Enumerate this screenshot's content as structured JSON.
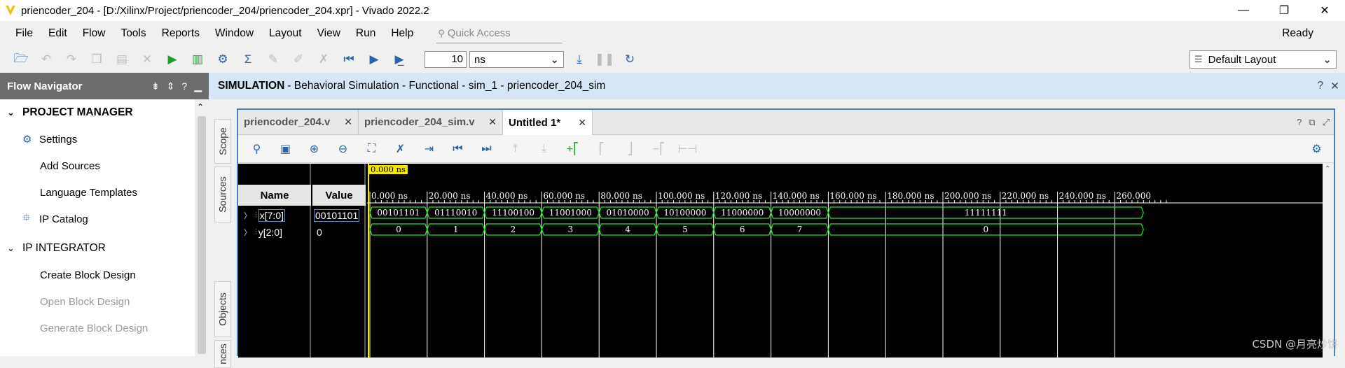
{
  "window": {
    "title": "priencoder_204 - [D:/Xilinx/Project/priencoder_204/priencoder_204.xpr] - Vivado 2022.2",
    "controls": {
      "minimize": "—",
      "restore": "❐",
      "close": "✕"
    }
  },
  "menu": {
    "items": [
      "File",
      "Edit",
      "Flow",
      "Tools",
      "Reports",
      "Window",
      "Layout",
      "View",
      "Run",
      "Help"
    ],
    "quick_access_placeholder": "Quick Access",
    "status": "Ready"
  },
  "toolbar": {
    "run_time_value": "10",
    "run_time_unit": "ns",
    "layout": "Default Layout"
  },
  "flow_navigator": {
    "title": "Flow Navigator",
    "sections": [
      {
        "label": "PROJECT MANAGER",
        "items": [
          "Settings",
          "Add Sources",
          "Language Templates",
          "IP Catalog"
        ]
      },
      {
        "label": "IP INTEGRATOR",
        "items": [
          "Create Block Design",
          "Open Block Design",
          "Generate Block Design"
        ]
      }
    ]
  },
  "sim_header": {
    "label": "SIMULATION",
    "text": "- Behavioral Simulation - Functional - sim_1 - priencoder_204_sim"
  },
  "side_tabs": [
    "Scope",
    "Sources",
    "Objects",
    "nces"
  ],
  "editor_tabs": [
    {
      "label": "priencoder_204.v",
      "active": false
    },
    {
      "label": "priencoder_204_sim.v",
      "active": false
    },
    {
      "label": "Untitled 1*",
      "active": true
    }
  ],
  "waveform": {
    "cursor_label": "0.000 ns",
    "columns": {
      "name": "Name",
      "value": "Value"
    },
    "time_ticks": [
      "0.000 ns",
      "20.000 ns",
      "40.000 ns",
      "60.000 ns",
      "80.000 ns",
      "100.000 ns",
      "120.000 ns",
      "140.000 ns",
      "160.000 ns",
      "180.000 ns",
      "200.000 ns",
      "220.000 ns",
      "240.000 ns",
      "260.000"
    ],
    "tick_step_ns": 20,
    "signals": [
      {
        "name": "x[7:0]",
        "value": "00101101",
        "segments": [
          {
            "start": 0,
            "end": 20,
            "label": "00101101"
          },
          {
            "start": 20,
            "end": 40,
            "label": "01110010"
          },
          {
            "start": 40,
            "end": 60,
            "label": "11100100"
          },
          {
            "start": 60,
            "end": 80,
            "label": "11001000"
          },
          {
            "start": 80,
            "end": 100,
            "label": "01010000"
          },
          {
            "start": 100,
            "end": 120,
            "label": "10100000"
          },
          {
            "start": 120,
            "end": 140,
            "label": "11000000"
          },
          {
            "start": 140,
            "end": 160,
            "label": "10000000"
          },
          {
            "start": 160,
            "end": 270,
            "label": "11111111"
          }
        ]
      },
      {
        "name": "y[2:0]",
        "value": "0",
        "segments": [
          {
            "start": 0,
            "end": 20,
            "label": "0"
          },
          {
            "start": 20,
            "end": 40,
            "label": "1"
          },
          {
            "start": 40,
            "end": 60,
            "label": "2"
          },
          {
            "start": 60,
            "end": 80,
            "label": "3"
          },
          {
            "start": 80,
            "end": 100,
            "label": "4"
          },
          {
            "start": 100,
            "end": 120,
            "label": "5"
          },
          {
            "start": 120,
            "end": 140,
            "label": "6"
          },
          {
            "start": 140,
            "end": 160,
            "label": "7"
          },
          {
            "start": 160,
            "end": 270,
            "label": "0"
          }
        ]
      }
    ],
    "colors": {
      "background": "#000000",
      "trace": "#26e626",
      "cursor": "#f2e600",
      "grid": "#ffffff"
    }
  },
  "watermark": "CSDN @月亮炒饼"
}
